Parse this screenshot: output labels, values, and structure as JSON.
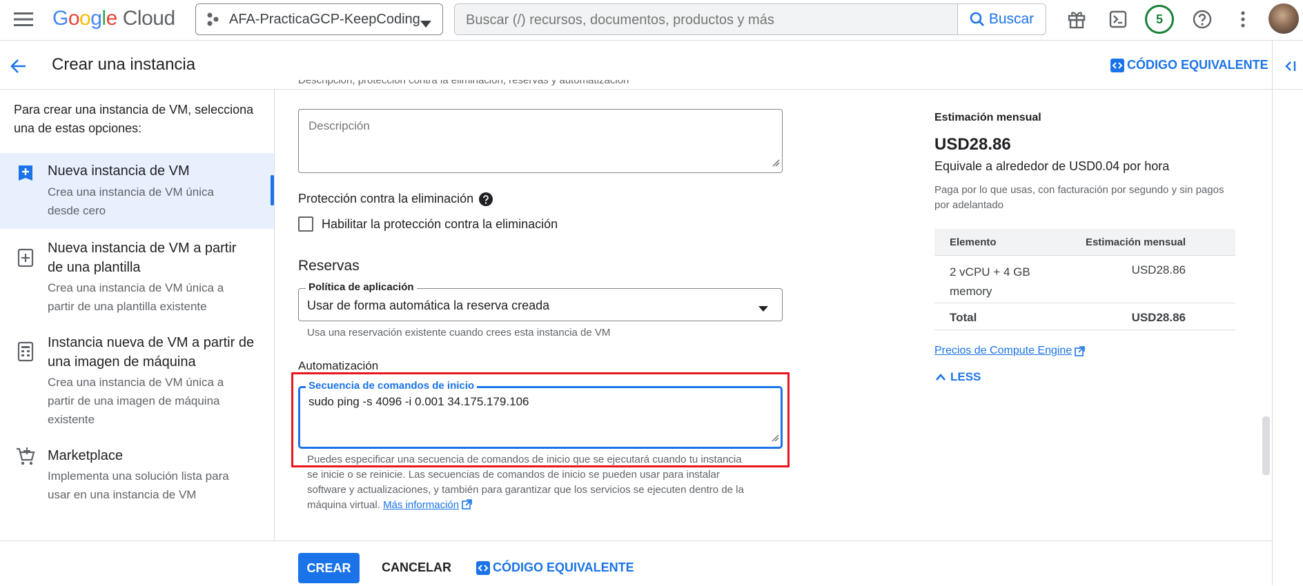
{
  "topbar": {
    "logo_letters": [
      "G",
      "o",
      "o",
      "g",
      "l",
      "e"
    ],
    "logo_cloud": "Cloud",
    "project": "AFA-PracticaGCP-KeepCoding",
    "search_placeholder": "Buscar (/) recursos, documentos, productos y más",
    "search_button": "Buscar",
    "notification_count": "5"
  },
  "header": {
    "title": "Crear una instancia",
    "equivalent_code": "CÓDIGO EQUIVALENTE"
  },
  "sidebar": {
    "intro": "Para crear una instancia de VM, selecciona una de estas opciones:",
    "items": [
      {
        "title": "Nueva instancia de VM",
        "desc": "Crea una instancia de VM única desde cero",
        "icon": "add-box-icon"
      },
      {
        "title": "Nueva instancia de VM a partir de una plantilla",
        "desc": "Crea una instancia de VM única a partir de una plantilla existente",
        "icon": "template-add-icon"
      },
      {
        "title": "Instancia nueva de VM a partir de una imagen de máquina",
        "desc": "Crea una instancia de VM única a partir de una imagen de máquina existente",
        "icon": "machine-image-icon"
      },
      {
        "title": "Marketplace",
        "desc": "Implementa una solución lista para usar en una instancia de VM",
        "icon": "cart-icon"
      }
    ]
  },
  "form": {
    "truncated_text": "Descripción, protección contra la eliminación, reservas y automatización",
    "description_placeholder": "Descripción",
    "deletion_protection_title": "Protección contra la eliminación",
    "deletion_protection_checkbox": "Habilitar la protección contra la eliminación",
    "reservations_heading": "Reservas",
    "policy_label": "Política de aplicación",
    "policy_value": "Usar de forma automática la reserva creada",
    "policy_hint": "Usa una reservación existente cuando crees esta instancia de VM",
    "automation_heading": "Automatización",
    "startup_label": "Secuencia de comandos de inicio",
    "startup_value": "sudo ping -s 4096 -i 0.001 34.175.179.106",
    "startup_hint": "Puedes especificar una secuencia de comandos de inicio que se ejecutará cuando tu instancia se inicie o se reinicie. Las secuencias de comandos de inicio se pueden usar para instalar software y actualizaciones, y también para garantizar que los servicios se ejecuten dentro de la máquina virtual.",
    "more_info": "Más información"
  },
  "pricing": {
    "heading": "Estimación mensual",
    "total_big": "USD28.86",
    "hourly": "Equivale a alrededor de USD0.04 por hora",
    "note": "Paga por lo que usas, con facturación por segundo y sin pagos por adelantado",
    "col_item": "Elemento",
    "col_estimate": "Estimación mensual",
    "rows": [
      {
        "item": "2 vCPU + 4 GB memory",
        "value": "USD28.86"
      }
    ],
    "total_label": "Total",
    "total_value": "USD28.86",
    "link": "Precios de Compute Engine",
    "less": "LESS"
  },
  "bottom": {
    "create": "CREAR",
    "cancel": "CANCELAR",
    "equivalent_code": "CÓDIGO EQUIVALENTE"
  },
  "colors": {
    "accent": "#1a73e8",
    "highlight_box": "#e8141c",
    "notification_ring": "#188038"
  }
}
